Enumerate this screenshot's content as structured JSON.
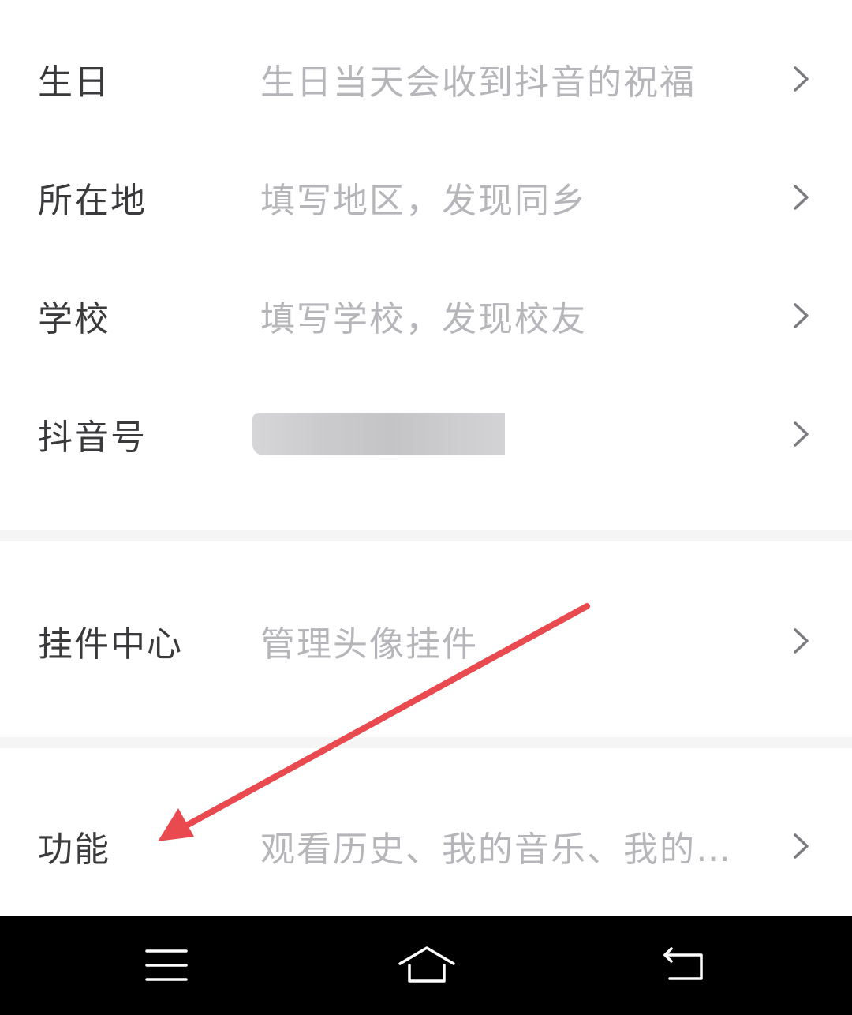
{
  "rows": [
    {
      "label": "生日",
      "value": "生日当天会收到抖音的祝福"
    },
    {
      "label": "所在地",
      "value": "填写地区，发现同乡"
    },
    {
      "label": "学校",
      "value": "填写学校，发现校友"
    },
    {
      "label": "抖音号",
      "value": ""
    },
    {
      "label": "挂件中心",
      "value": "管理头像挂件"
    },
    {
      "label": "功能",
      "value": "观看历史、我的音乐、我的…"
    }
  ],
  "icons": {
    "chevron": "chevron-right-icon",
    "menu": "menu-icon",
    "home": "home-icon",
    "back": "back-icon",
    "annotation": "red-arrow-annotation"
  },
  "colors": {
    "label": "#3a3a3c",
    "value": "#b5b5ba",
    "chevron": "#7c7c80",
    "separator": "#f5f5f6",
    "annotation_arrow": "#e84a4f",
    "navbar": "#000000"
  }
}
